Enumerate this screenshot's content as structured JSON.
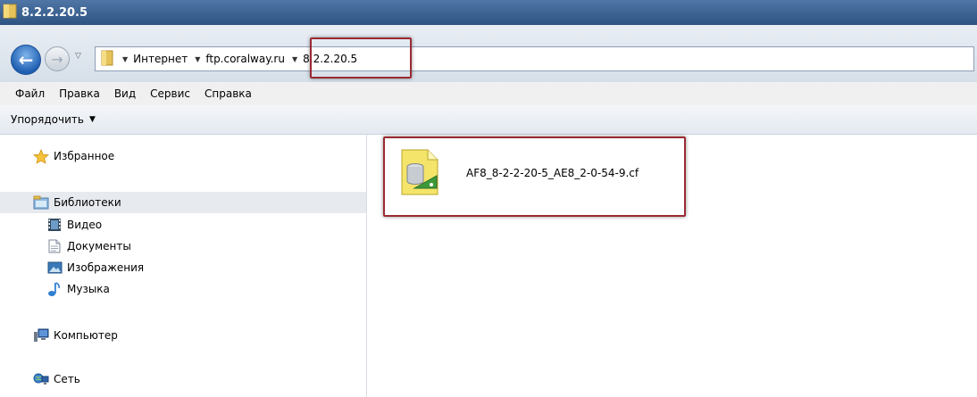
{
  "window": {
    "title": "8.2.2.20.5"
  },
  "navigation": {
    "back_icon": "back-arrow-icon",
    "forward_icon": "forward-arrow-icon",
    "breadcrumbs": [
      {
        "label": "Интернет"
      },
      {
        "label": "ftp.coralway.ru"
      },
      {
        "label": "8.2.2.20.5"
      }
    ]
  },
  "menu": {
    "items": [
      "Файл",
      "Правка",
      "Вид",
      "Сервис",
      "Справка"
    ]
  },
  "toolbar": {
    "organize_label": "Упорядочить"
  },
  "sidebar": {
    "favorites": {
      "label": "Избранное",
      "icon": "star-icon"
    },
    "libraries": {
      "label": "Библиотеки",
      "icon": "libraries-icon",
      "children": [
        {
          "label": "Видео",
          "icon": "video-icon"
        },
        {
          "label": "Документы",
          "icon": "documents-icon"
        },
        {
          "label": "Изображения",
          "icon": "pictures-icon"
        },
        {
          "label": "Музыка",
          "icon": "music-icon"
        }
      ]
    },
    "computer": {
      "label": "Компьютер",
      "icon": "computer-icon"
    },
    "network": {
      "label": "Сеть",
      "icon": "network-icon"
    }
  },
  "files": [
    {
      "name": "AF8_8-2-2-20-5_AE8_2-0-54-9.cf",
      "icon": "config-file-icon"
    }
  ],
  "colors": {
    "title_bar": "#3a5f8c",
    "highlight_border": "#9b2a32",
    "selected_row": "#e7eaef"
  }
}
